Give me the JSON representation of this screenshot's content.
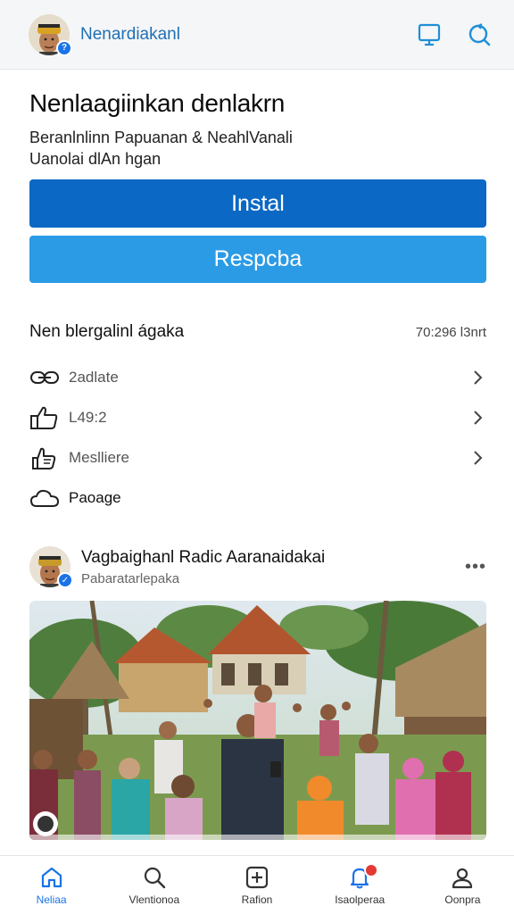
{
  "header": {
    "app_title": "Nenardiakanl",
    "icons": [
      "avatar",
      "monitor-icon",
      "refresh-search-icon"
    ]
  },
  "hero": {
    "title": "Nenlaagiinkan denlakrn",
    "subtitle_line1": "Beranlnlinn Papuanan & NeahlVanali",
    "subtitle_line2": "Uanolai dlAn hgan"
  },
  "actions": {
    "primary_label": "Instal",
    "secondary_label": "Respcba"
  },
  "details": {
    "heading": "Nen blergalinl ágaka",
    "heading_value": "70:296 l3nrt",
    "rows": [
      {
        "icon": "link-icon",
        "label": "2adlate"
      },
      {
        "icon": "thumbs-up-icon",
        "label": "L49:2"
      },
      {
        "icon": "hand-icon",
        "label": "Meslliere"
      },
      {
        "icon": "cloud-icon",
        "label": "Paoage"
      }
    ]
  },
  "post": {
    "author": "Vagbaighanl Radic Aaranaidakai",
    "subtitle": "Pabaratarlepaka",
    "more": "•••"
  },
  "bottom_nav": [
    {
      "label": "Neliaa",
      "icon": "home-icon",
      "active": true
    },
    {
      "label": "Vlentionoa",
      "icon": "search-icon",
      "active": false
    },
    {
      "label": "Rafion",
      "icon": "add-box-icon",
      "active": false
    },
    {
      "label": "Isaolperaa",
      "icon": "notifications-icon",
      "active": false
    },
    {
      "label": "Oonpra",
      "icon": "profile-icon",
      "active": false
    }
  ],
  "colors": {
    "primary": "#0b68c4",
    "secondary": "#2b9be6",
    "accent": "#1a73e8"
  }
}
